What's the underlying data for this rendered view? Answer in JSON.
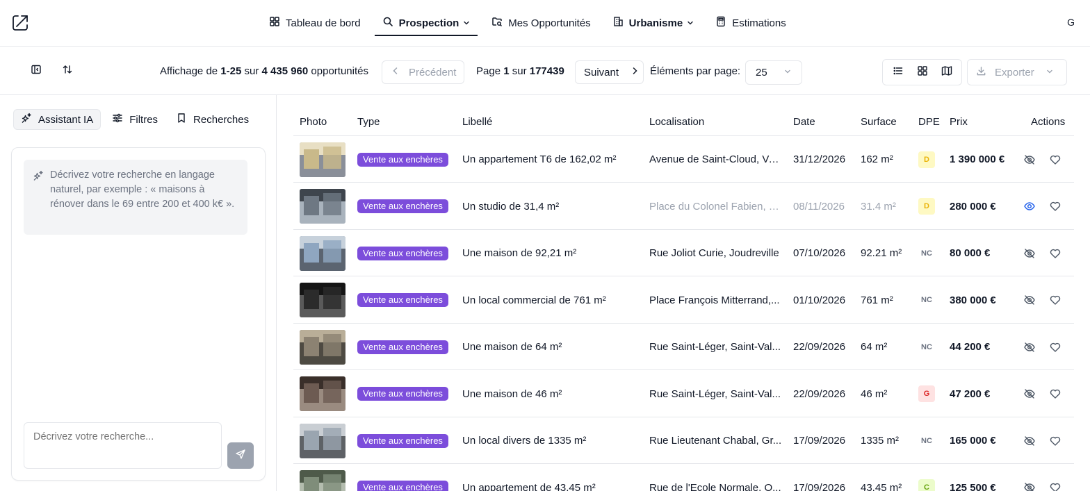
{
  "nav": {
    "items": [
      {
        "label": "Tableau de bord",
        "icon": "dashboard-grid-icon"
      },
      {
        "label": "Prospection",
        "icon": "search-icon"
      },
      {
        "label": "Mes Opportunités",
        "icon": "folder-search-icon"
      },
      {
        "label": "Urbanisme",
        "icon": "building-icon"
      },
      {
        "label": "Estimations",
        "icon": "calculator-icon"
      }
    ],
    "user_initial": "G"
  },
  "toolbar": {
    "affichage_prefix": "Affichage de",
    "range": "1-25",
    "sur": "sur",
    "total": "4 435 960",
    "unit": "opportunités",
    "prev_label": "Précédent",
    "page_prefix": "Page",
    "page_current": "1",
    "page_total": "177439",
    "next_label": "Suivant",
    "per_page_label": "Éléments par page:",
    "per_page_value": "25",
    "export_label": "Exporter"
  },
  "sidebar": {
    "tabs": [
      {
        "label": "Assistant IA",
        "icon": "sparkles-icon"
      },
      {
        "label": "Filtres",
        "icon": "sliders-icon"
      },
      {
        "label": "Recherches",
        "icon": "bookmark-icon"
      }
    ],
    "hint": "Décrivez votre recherche en langage naturel, par exemple : « maisons à rénover dans le 69 entre 200 et 400 k€ ».",
    "input_placeholder": "Décrivez votre recherche..."
  },
  "table": {
    "headers": {
      "photo": "Photo",
      "type": "Type",
      "libelle": "Libellé",
      "localisation": "Localisation",
      "date": "Date",
      "surface": "Surface",
      "dpe": "DPE",
      "prix": "Prix",
      "actions": "Actions"
    },
    "rows": [
      {
        "type": "Vente aux enchères",
        "libelle": "Un appartement T6 de 162,02 m²",
        "localisation": "Avenue de Saint-Cloud, Ve...",
        "date": "31/12/2026",
        "surface": "162 m²",
        "dpe": "D",
        "prix": "1 390 000 €",
        "visibility": "hidden"
      },
      {
        "type": "Vente aux enchères",
        "libelle": "Un studio de 31,4 m²",
        "localisation": "Place du Colonel Fabien, P...",
        "date": "08/11/2026",
        "surface": "31.4 m²",
        "dpe": "D",
        "prix": "280 000 €",
        "visibility": "visible"
      },
      {
        "type": "Vente aux enchères",
        "libelle": "Une maison de 92,21 m²",
        "localisation": "Rue Joliot Curie, Joudreville",
        "date": "07/10/2026",
        "surface": "92.21 m²",
        "dpe": "NC",
        "prix": "80 000 €",
        "visibility": "hidden"
      },
      {
        "type": "Vente aux enchères",
        "libelle": "Un local commercial de 761 m²",
        "localisation": "Place François Mitterrand,...",
        "date": "01/10/2026",
        "surface": "761 m²",
        "dpe": "NC",
        "prix": "380 000 €",
        "visibility": "hidden"
      },
      {
        "type": "Vente aux enchères",
        "libelle": "Une maison de 64 m²",
        "localisation": "Rue Saint-Léger, Saint-Val...",
        "date": "22/09/2026",
        "surface": "64 m²",
        "dpe": "NC",
        "prix": "44 200 €",
        "visibility": "hidden"
      },
      {
        "type": "Vente aux enchères",
        "libelle": "Une maison de 46 m²",
        "localisation": "Rue Saint-Léger, Saint-Val...",
        "date": "22/09/2026",
        "surface": "46 m²",
        "dpe": "G",
        "prix": "47 200 €",
        "visibility": "hidden"
      },
      {
        "type": "Vente aux enchères",
        "libelle": "Un local divers de 1335 m²",
        "localisation": "Rue Lieutenant Chabal, Gr...",
        "date": "17/09/2026",
        "surface": "1335 m²",
        "dpe": "NC",
        "prix": "165 000 €",
        "visibility": "hidden"
      },
      {
        "type": "Vente aux enchères",
        "libelle": "Un appartement de 43,45 m²",
        "localisation": "Rue de l'Ecole Normale, O...",
        "date": "17/09/2026",
        "surface": "43.45 m²",
        "dpe": "C",
        "prix": "125 500 €",
        "visibility": "hidden"
      }
    ]
  },
  "colors": {
    "badge": "#7c4ddb",
    "visible_eye": "#2563eb",
    "dpe_D_bg": "#fef9c3",
    "dpe_D_fg": "#eab308",
    "dpe_G_bg": "#fee2e2",
    "dpe_G_fg": "#dc2626",
    "dpe_C_bg": "#ecfccb",
    "dpe_C_fg": "#65a30d",
    "dpe_NC_fg": "#6b7280"
  }
}
